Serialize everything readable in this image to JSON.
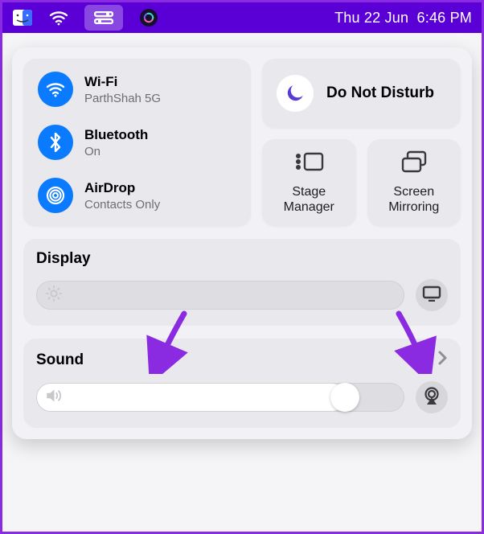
{
  "menubar": {
    "datetime": "Thu 22 Jun  6:46 PM"
  },
  "connectivity": {
    "wifi": {
      "title": "Wi-Fi",
      "sub": "ParthShah 5G"
    },
    "bluetooth": {
      "title": "Bluetooth",
      "sub": "On"
    },
    "airdrop": {
      "title": "AirDrop",
      "sub": "Contacts Only"
    }
  },
  "focus": {
    "title": "Do Not Disturb"
  },
  "stage_manager": {
    "label": "Stage Manager"
  },
  "screen_mirroring": {
    "label": "Screen Mirroring"
  },
  "display": {
    "title": "Display",
    "brightness_percent": 0
  },
  "sound": {
    "title": "Sound",
    "volume_percent": 84
  }
}
